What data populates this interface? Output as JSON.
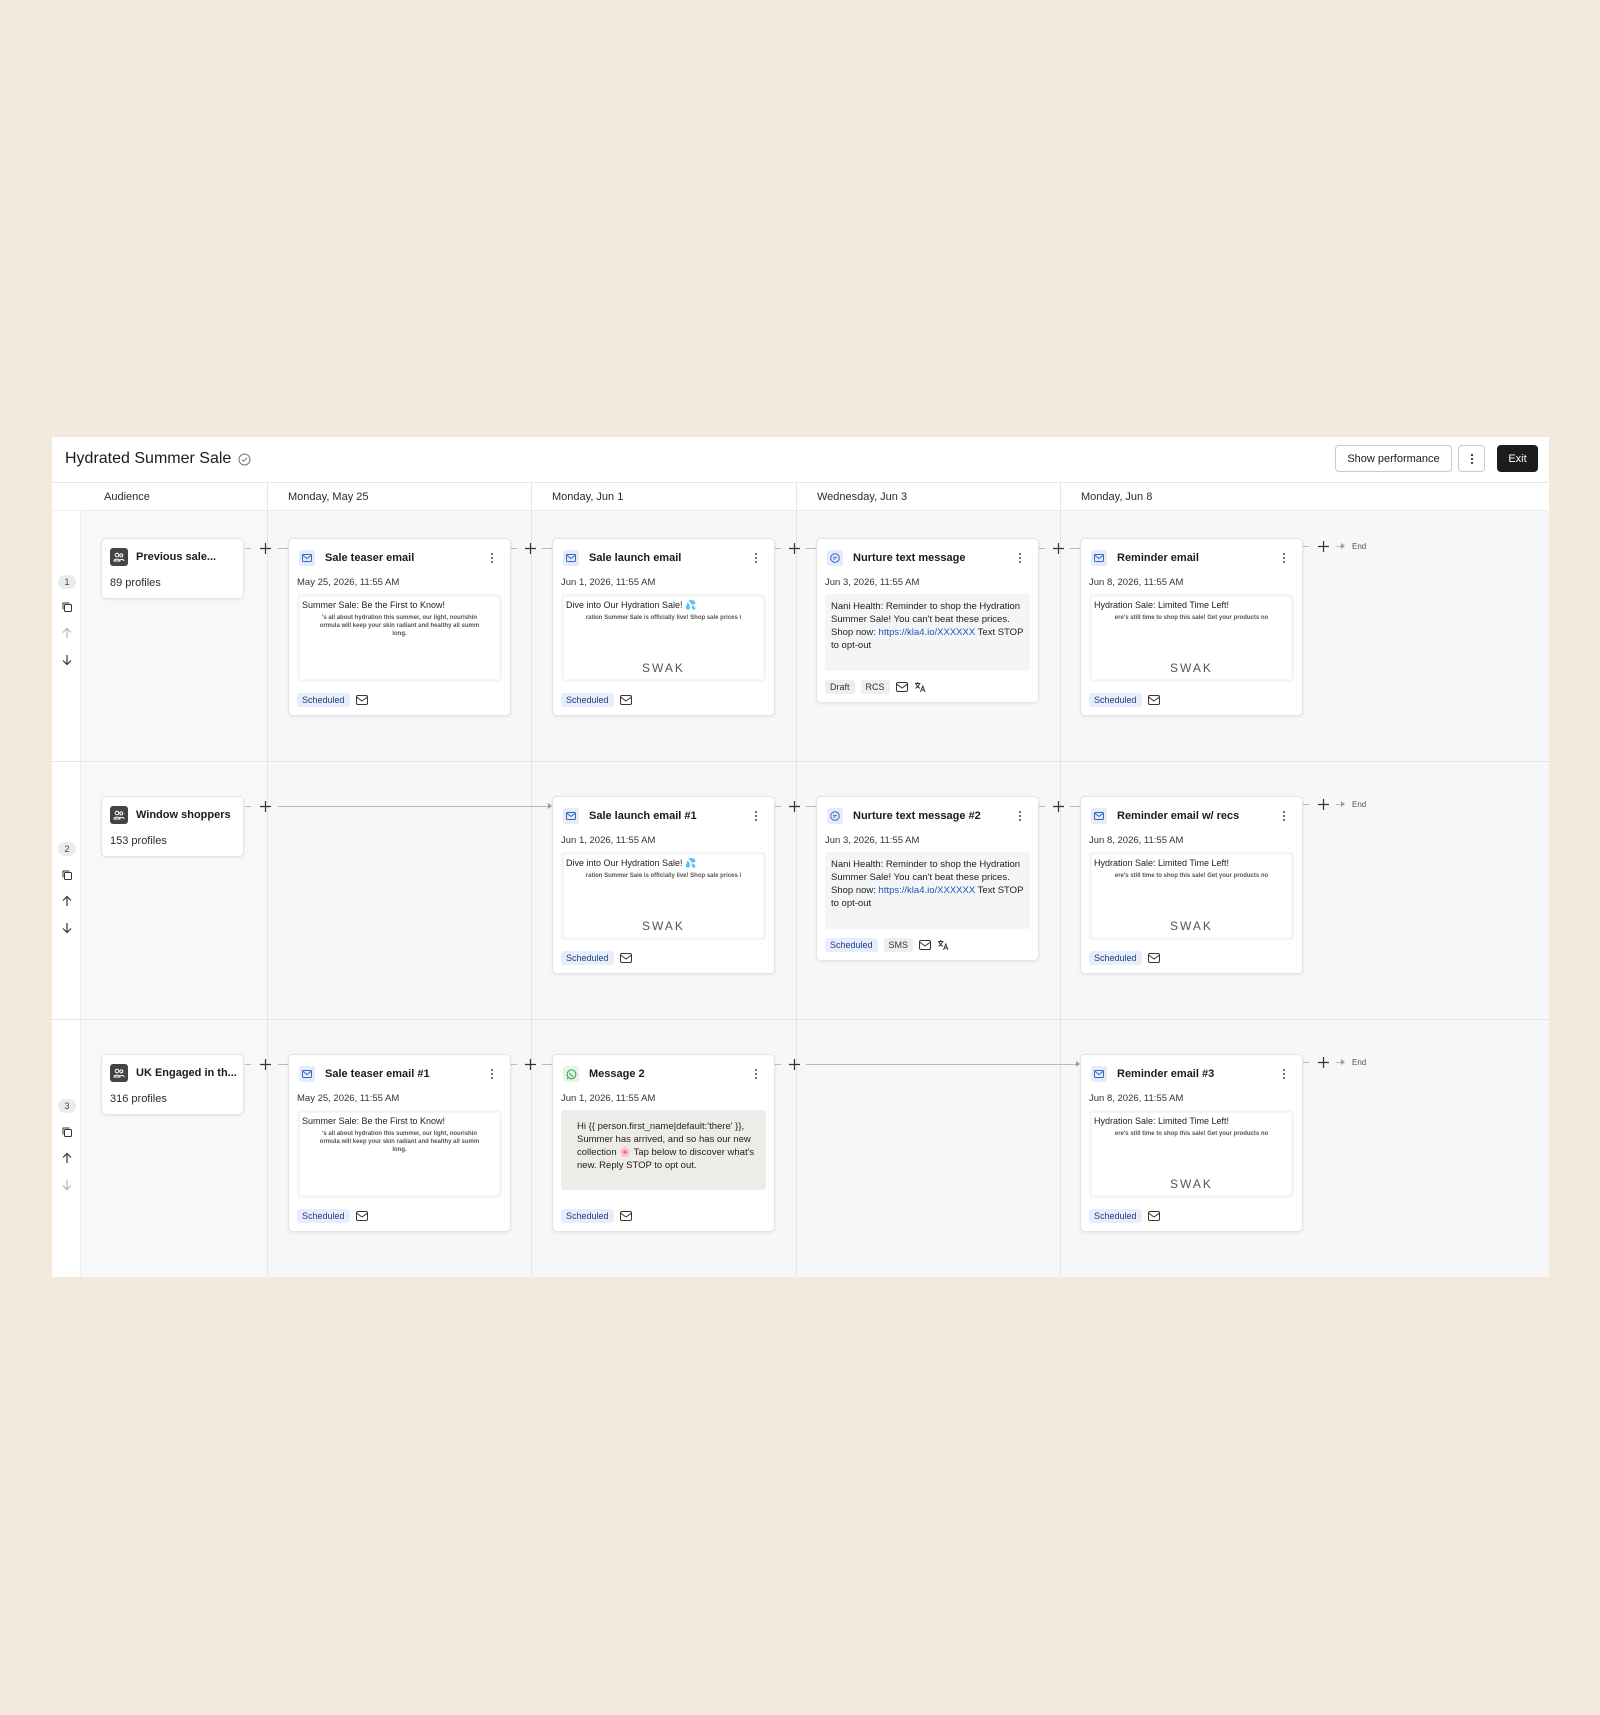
{
  "app": {
    "title": "Hydrated Summer Sale",
    "buttons": {
      "performance": "Show performance",
      "exit": "Exit"
    }
  },
  "columns": [
    "Audience",
    "Monday, May 25",
    "Monday, Jun 1",
    "Wednesday, Jun 3",
    "Monday, Jun 8"
  ],
  "end_label": "End",
  "rows": [
    {
      "number": "1",
      "audience": {
        "name": "Previous sale...",
        "count": "89 profiles"
      },
      "cards": [
        {
          "title": "Sale teaser email",
          "date": "May 25, 2026, 11:55 AM",
          "subject": "Summer Sale: Be the First to Know!",
          "body1": "'s all about hydration this summer, our light, nourishin",
          "body2": "ormula will keep your skin radiant and healthy all summ",
          "body3": "long.",
          "status": "Scheduled"
        },
        {
          "title": "Sale launch email",
          "date": "Jun 1, 2026, 11:55 AM",
          "subject": "Dive into Our Hydration Sale! 💦",
          "body1": "ration Summer Sale is officially live! Shop sale prices i",
          "logo": "SWAK",
          "status": "Scheduled"
        },
        {
          "title": "Nurture text message",
          "date": "Jun 3, 2026, 11:55 AM",
          "text_before": "Nani Health: Reminder to shop the Hydration Summer Sale! You can't beat these prices. Shop now: ",
          "link": "https://kla4.io/XXXXXX",
          "text_after": " Text STOP to opt-out",
          "status": "Draft",
          "channel": "RCS"
        },
        {
          "title": "Reminder email",
          "date": "Jun 8, 2026, 11:55 AM",
          "subject": "Hydration Sale: Limited Time Left!",
          "body1": "ere's still time to shop this sale! Get your products no",
          "logo": "SWAK",
          "status": "Scheduled"
        }
      ]
    },
    {
      "number": "2",
      "audience": {
        "name": "Window shoppers",
        "count": "153 profiles"
      },
      "cards": [
        {
          "title": "Sale launch email #1",
          "date": "Jun 1, 2026, 11:55 AM",
          "subject": "Dive into Our Hydration Sale! 💦",
          "body1": "ration Summer Sale is officially live! Shop sale prices i",
          "logo": "SWAK",
          "status": "Scheduled"
        },
        {
          "title": "Nurture text message #2",
          "date": "Jun 3, 2026, 11:55 AM",
          "text_before": "Nani Health: Reminder to shop the Hydration Summer Sale! You can't beat these prices. Shop now: ",
          "link": "https://kla4.io/XXXXXX",
          "text_after": " Text STOP to opt-out",
          "status": "Scheduled",
          "channel": "SMS"
        },
        {
          "title": "Reminder email w/ recs",
          "date": "Jun 8, 2026, 11:55 AM",
          "subject": "Hydration Sale: Limited Time Left!",
          "body1": "ere's still time to shop this sale! Get your products no",
          "logo": "SWAK",
          "status": "Scheduled"
        }
      ]
    },
    {
      "number": "3",
      "audience": {
        "name": "UK Engaged in th...",
        "count": "316 profiles"
      },
      "cards": [
        {
          "title": "Sale teaser email #1",
          "date": "May 25, 2026, 11:55 AM",
          "subject": "Summer Sale: Be the First to Know!",
          "body1": "'s all about hydration this summer, our light, nourishin",
          "body2": "ormula will keep your skin radiant and healthy all summ",
          "body3": "long.",
          "status": "Scheduled"
        },
        {
          "title": "Message 2",
          "date": "Jun 1, 2026, 11:55 AM",
          "wa_text": "Hi {{ person.first_name|default:'there' }}, Summer has arrived, and so has our new collection 🌸 Tap below to discover what's new. Reply STOP to opt out.",
          "status": "Scheduled"
        },
        {
          "title": "Reminder email #3",
          "date": "Jun 8, 2026, 11:55 AM",
          "subject": "Hydration Sale: Limited Time Left!",
          "body1": "ere's still time to shop this sale! Get your products no",
          "logo": "SWAK",
          "status": "Scheduled"
        }
      ]
    }
  ],
  "colors": {
    "exit_bg": "#1c1c1c",
    "badge_scheduled": "#e6eefb",
    "link": "#2453b8",
    "background": "#f3eadd"
  }
}
